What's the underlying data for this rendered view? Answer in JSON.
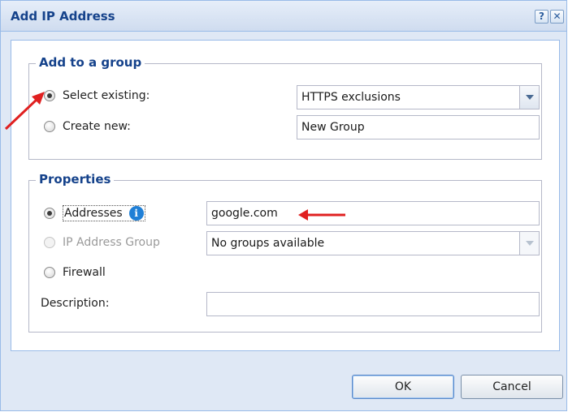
{
  "window": {
    "title": "Add IP Address",
    "help_icon": "?",
    "close_icon": "✕"
  },
  "group_section": {
    "legend": "Add to a group",
    "select_existing_label": "Select existing:",
    "select_existing_value": "HTTPS exclusions",
    "create_new_label": "Create new:",
    "create_new_value": "New Group"
  },
  "properties_section": {
    "legend": "Properties",
    "addresses_label": "Addresses",
    "addresses_info_icon": "i",
    "addresses_value": "google.com",
    "ip_group_label": "IP Address Group",
    "ip_group_value": "No groups available",
    "firewall_label": "Firewall",
    "description_label": "Description:",
    "description_value": ""
  },
  "buttons": {
    "ok": "OK",
    "cancel": "Cancel"
  },
  "colors": {
    "accent_title": "#15428b",
    "annotation_arrow": "#e02020"
  }
}
